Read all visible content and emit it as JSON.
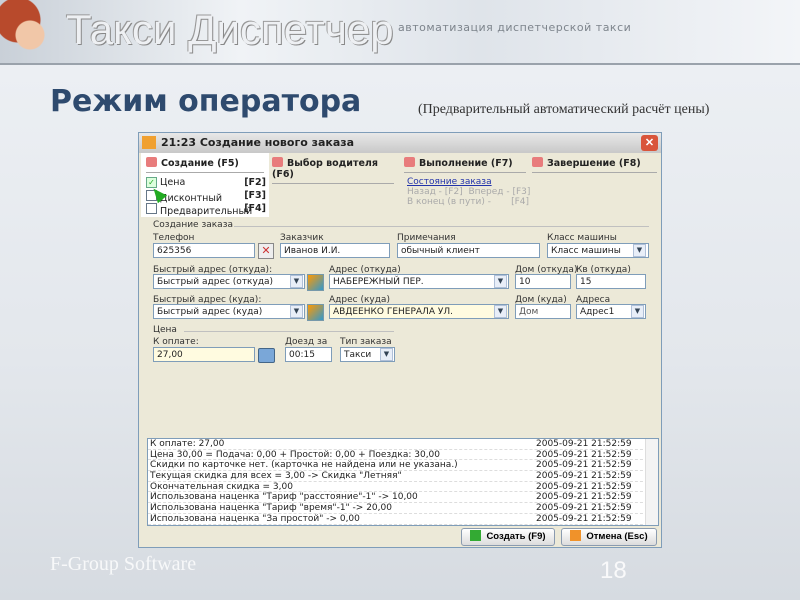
{
  "banner": {
    "logo": "Такси Диспетчер",
    "tagline": "автоматизация диспетчерской такси"
  },
  "slide": {
    "title": "Режим оператора",
    "subtitle": "(Предварительный автоматический расчёт цены)",
    "footer": "F-Group Software",
    "page": "18"
  },
  "window": {
    "title": "21:23 Создание нового заказа",
    "close": "✕",
    "tabs": [
      "Создание (F5)",
      "Выбор водителя (F6)",
      "Выполнение (F7)",
      "Завершение (F8)"
    ],
    "price_options": [
      {
        "label": "Цена",
        "key": "[F2]",
        "checked": true
      },
      {
        "label": "Дисконтный",
        "key": "[F3]",
        "checked": false
      },
      {
        "label": "Предварительный",
        "key": "[F4]",
        "checked": false
      }
    ],
    "status": {
      "link": "Состояние заказа",
      "back": "Назад - [F2]",
      "forward": "Вперед - [F3]",
      "end": "В конец (в пути) -",
      "end_key": "[F4]"
    },
    "group_order": "Создание заказа",
    "fields": {
      "phone_label": "Телефон",
      "phone": "625356",
      "customer_label": "Заказчик",
      "customer": "Иванов И.И.",
      "notes_label": "Примечания",
      "notes": "обычный клиент",
      "class_label": "Класс машины",
      "class": "Класс машины",
      "quick_from_label": "Быстрый адрес (откуда):",
      "quick_from": "Быстрый адрес (откуда)",
      "addr_from_label": "Адрес (откуда)",
      "addr_from": "НАБЕРЕЖНЫЙ ПЕР.",
      "house_from_label": "Дом (откуда)",
      "house_from": "10",
      "flat_from_label": "Кв (откуда)",
      "flat_from": "15",
      "quick_to_label": "Быстрый адрес (куда):",
      "quick_to": "Быстрый адрес (куда)",
      "addr_to_label": "Адрес (куда)",
      "addr_to": "АВДЕЕНКО ГЕНЕРАЛА УЛ.",
      "house_to_label": "Дом (куда)",
      "house_to": "Дом",
      "addrs_label": "Адреса",
      "addrs": "Адрес1"
    },
    "group_price": "Цена",
    "price": {
      "pay_label": "К оплате:",
      "pay": "27,00",
      "eta_label": "Доезд за",
      "eta": "00:15",
      "type_label": "Тип заказа",
      "type": "Такси"
    },
    "log": [
      {
        "msg": "К оплате: 27,00",
        "ts": "2005-09-21 21:52:59"
      },
      {
        "msg": "Цена 30,00 = Подача: 0,00 + Простой: 0,00 + Поездка: 30,00",
        "ts": "2005-09-21 21:52:59"
      },
      {
        "msg": "Скидки по карточке нет. (карточка не найдена или не указана.)",
        "ts": "2005-09-21 21:52:59"
      },
      {
        "msg": "Текущая скидка для всех = 3,00 -> Скидка \"Летняя\"",
        "ts": "2005-09-21 21:52:59"
      },
      {
        "msg": "Окончательная скидка = 3,00",
        "ts": "2005-09-21 21:52:59"
      },
      {
        "msg": "Использована наценка \"Тариф \"расстояние\"-1\" -> 10,00",
        "ts": "2005-09-21 21:52:59"
      },
      {
        "msg": "Использована наценка \"Тариф \"время\"-1\" -> 20,00",
        "ts": "2005-09-21 21:52:59"
      },
      {
        "msg": "Использована наценка \"За простой\" -> 0,00",
        "ts": "2005-09-21 21:52:59"
      }
    ],
    "create_btn": "Создать (F9)",
    "cancel_btn": "Отмена (Esc)"
  }
}
